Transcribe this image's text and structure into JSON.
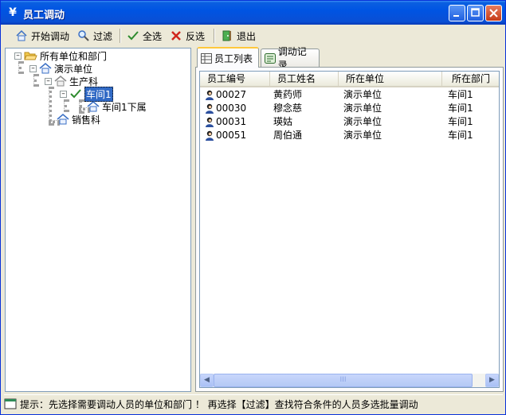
{
  "window": {
    "title": "员工调动",
    "title_icon": "¥"
  },
  "toolbar": {
    "start_transfer": "开始调动",
    "filter": "过滤",
    "select_all": "全选",
    "invert_select": "反选",
    "exit": "退出"
  },
  "tree": {
    "root": "所有单位和部门",
    "unit": "演示单位",
    "dept_production": "生产科",
    "workshop1": "车间1",
    "workshop1_sub": "车间1下属",
    "dept_sales": "销售科"
  },
  "tabs": {
    "employee_list": "员工列表",
    "transfer_records": "调动记录"
  },
  "table": {
    "columns": [
      "员工编号",
      "员工姓名",
      "所在单位",
      "所在部门"
    ],
    "rows": [
      [
        "00027",
        "黄药师",
        "演示单位",
        "车间1"
      ],
      [
        "00030",
        "穆念慈",
        "演示单位",
        "车间1"
      ],
      [
        "00031",
        "瑛姑",
        "演示单位",
        "车间1"
      ],
      [
        "00051",
        "周伯通",
        "演示单位",
        "车间1"
      ]
    ]
  },
  "scrollbar": {
    "thumb_grip": "III"
  },
  "status": {
    "hint": "提示：先选择需要调动人员的单位和部门 ！ 再选择【过滤】查找符合条件的人员多选批量调动"
  },
  "colors": {
    "title_blue": "#0054e3",
    "selection": "#316ac5",
    "tab_highlight": "#ffc83c"
  }
}
